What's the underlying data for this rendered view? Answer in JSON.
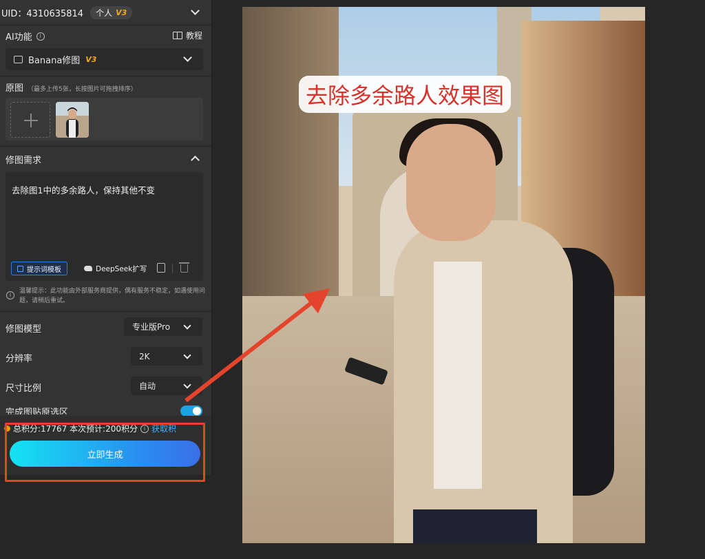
{
  "account": {
    "uid": "UID：4310635814",
    "plan": "个人",
    "plan_tier": "V3"
  },
  "ai_feature": {
    "label": "AI功能",
    "tutorial": "教程",
    "selected": "Banana修图",
    "selected_tier": "V3"
  },
  "source": {
    "label": "原图",
    "note": "（最多上传5张，长按图片可拖拽排序）"
  },
  "requirement": {
    "label": "修图需求",
    "text": "去除图1中的多余路人，保持其他不变",
    "template_button": "提示词模板",
    "deepseek_button": "DeepSeek扩写"
  },
  "tip": "温馨提示：此功能由外部服务商提供，偶有服务不稳定，如遇使用问题，请稍后重试。",
  "options": {
    "model_label": "修图模型",
    "model_value": "专业版Pro",
    "resolution_label": "分辨率",
    "resolution_value": "2K",
    "ratio_label": "尺寸比例",
    "ratio_value": "自动",
    "rotate_label": "完成图贴原选区"
  },
  "footer": {
    "points": "总积分:17767  本次预计:200积分",
    "get_more": "获取积",
    "generate": "立即生成"
  },
  "preview": {
    "caption": "去除多余路人效果图"
  },
  "colors": {
    "accent_blue": "#2a8cf0",
    "accent_cyan": "#14e3f2",
    "annotation_red": "#e5442c",
    "tier_orange": "#f5a623"
  }
}
